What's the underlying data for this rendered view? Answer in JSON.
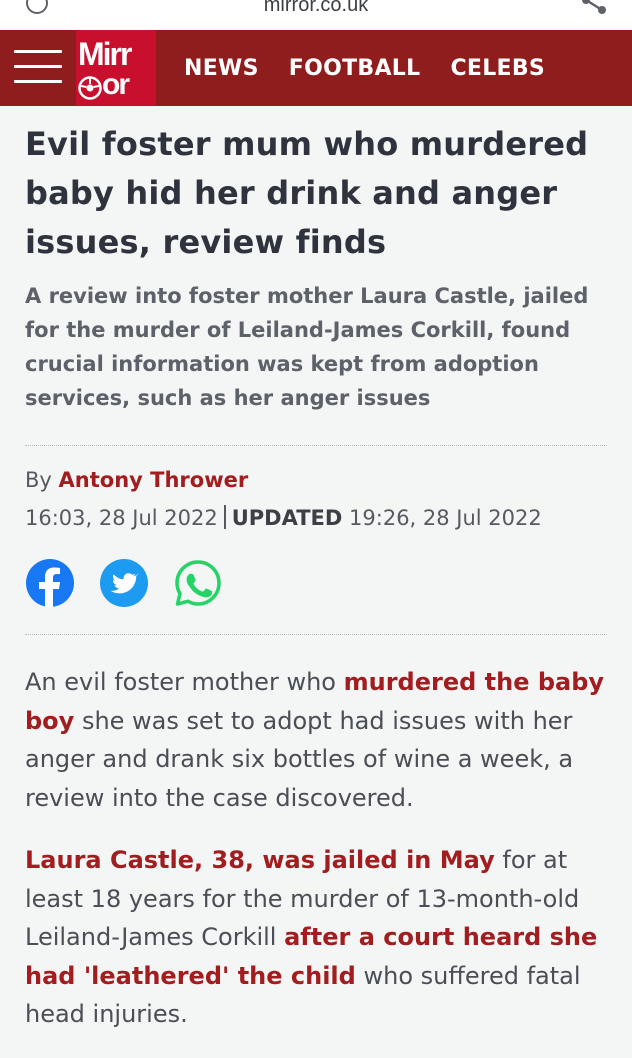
{
  "browser": {
    "url": "mirror.co.uk"
  },
  "header": {
    "logo_line1": "Mirr",
    "logo_line2": "or",
    "nav": [
      "NEWS",
      "FOOTBALL",
      "CELEBS"
    ],
    "colors": {
      "bar": "#8f1d1d",
      "logo": "#c8102e"
    }
  },
  "article": {
    "headline": "Evil foster mum who murdered baby hid her drink and anger issues, review finds",
    "standfirst": "A review into foster mother Laura Castle, jailed for the murder of Leiland-James Corkill, found crucial information was kept from adoption services, such as her anger issues",
    "byline_prefix": "By",
    "author": "Antony Thrower",
    "published": "16:03, 28 Jul 2022",
    "updated_label": "UPDATED",
    "updated": "19:26, 28 Jul 2022",
    "share_icons": [
      "facebook-icon",
      "twitter-icon",
      "whatsapp-icon"
    ],
    "para1": {
      "t1": "An evil foster mother who ",
      "link1": "murdered the baby boy",
      "t2": " she was set to adopt had issues with her anger and drank six bottles of wine a week, a review into the case discovered."
    },
    "para2": {
      "link1": "Laura Castle, 38, was jailed in May",
      "t1": " for at least 18 years for the murder of 13-month-old Leiland-James Corkill ",
      "link2": "after a court heard she had 'leathered' the child",
      "t2": " who suffered fatal head injuries."
    },
    "colors": {
      "accent": "#a11d1f",
      "text": "#4a4e55"
    }
  }
}
